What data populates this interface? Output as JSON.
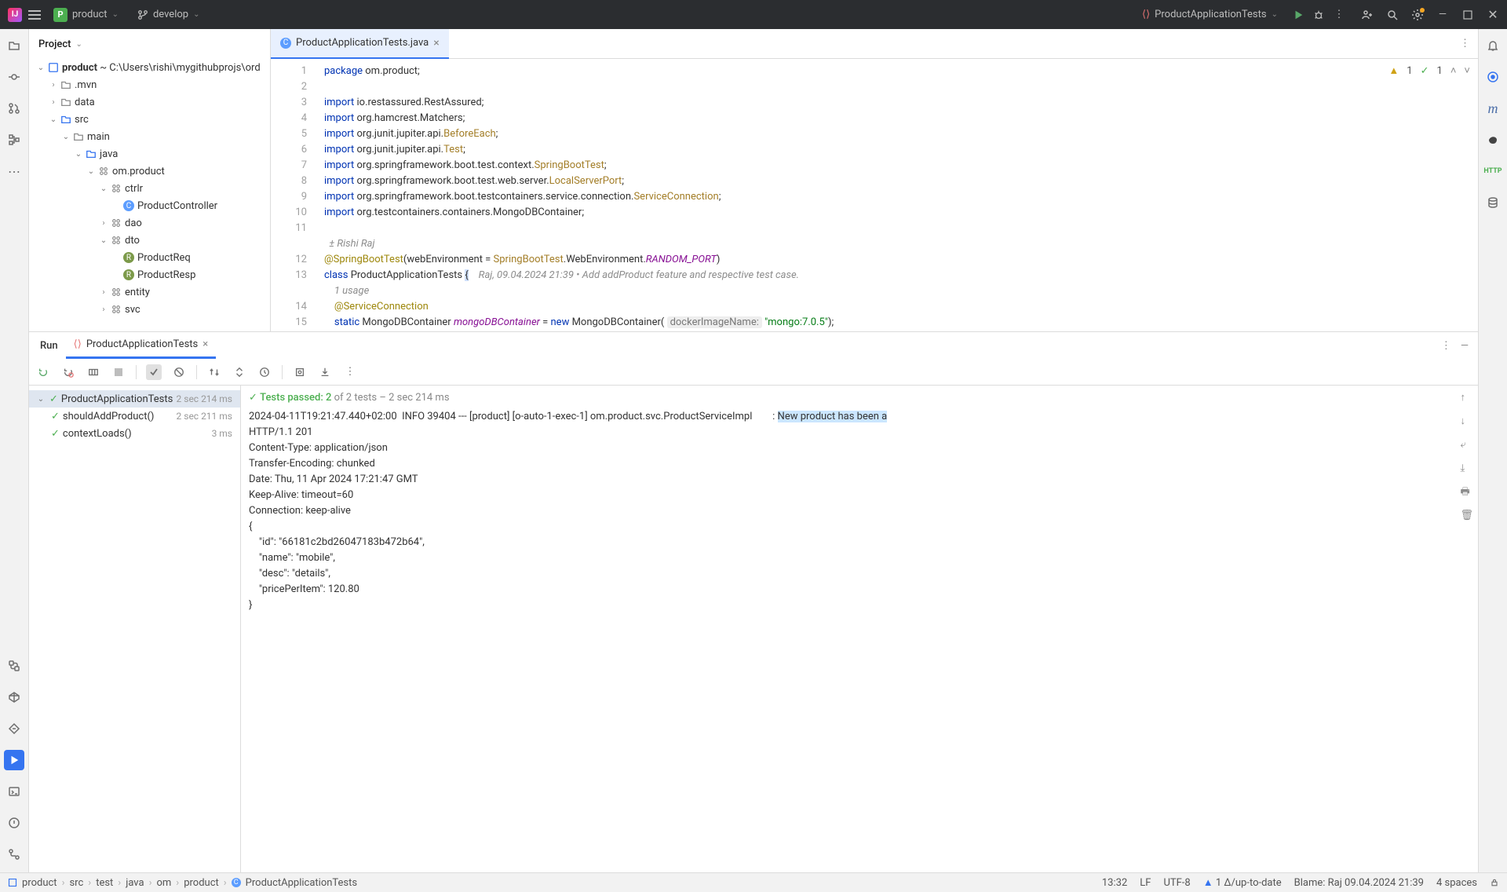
{
  "titlebar": {
    "project_name": "product",
    "branch": "develop",
    "run_config": "ProductApplicationTests"
  },
  "project_panel": {
    "title": "Project",
    "root": "product",
    "root_path": "~ C:\\Users\\rishi\\mygithubprojs\\ord",
    "tree": [
      {
        "indent": 1,
        "chev": "›",
        "type": "folder",
        "label": ".mvn"
      },
      {
        "indent": 1,
        "chev": "›",
        "type": "folder",
        "label": "data"
      },
      {
        "indent": 1,
        "chev": "⌄",
        "type": "src",
        "label": "src"
      },
      {
        "indent": 2,
        "chev": "⌄",
        "type": "folder",
        "label": "main"
      },
      {
        "indent": 3,
        "chev": "⌄",
        "type": "src",
        "label": "java"
      },
      {
        "indent": 4,
        "chev": "⌄",
        "type": "pkg",
        "label": "om.product"
      },
      {
        "indent": 5,
        "chev": "⌄",
        "type": "pkg",
        "label": "ctrlr"
      },
      {
        "indent": 6,
        "chev": "",
        "type": "class",
        "label": "ProductController"
      },
      {
        "indent": 5,
        "chev": "›",
        "type": "pkg",
        "label": "dao"
      },
      {
        "indent": 5,
        "chev": "⌄",
        "type": "pkg",
        "label": "dto"
      },
      {
        "indent": 6,
        "chev": "",
        "type": "record",
        "label": "ProductReq"
      },
      {
        "indent": 6,
        "chev": "",
        "type": "record",
        "label": "ProductResp"
      },
      {
        "indent": 5,
        "chev": "›",
        "type": "pkg",
        "label": "entity"
      },
      {
        "indent": 5,
        "chev": "›",
        "type": "pkg",
        "label": "svc"
      }
    ]
  },
  "editor": {
    "tab_file": "ProductApplicationTests.java",
    "author_hint": "Rishi Raj",
    "usage_hint": "1 usage",
    "blame_inline": "Raj, 09.04.2024 21:39 • Add addProduct feature and respective test case.",
    "inspections": {
      "warnings": "1",
      "passes": "1"
    },
    "lines": [
      {
        "n": "1",
        "html": "<span class='kw'>package</span> om.product;"
      },
      {
        "n": "2",
        "html": ""
      },
      {
        "n": "3",
        "html": "<span class='kw'>import</span> io.restassured.RestAssured;"
      },
      {
        "n": "4",
        "html": "<span class='kw'>import</span> org.hamcrest.Matchers;"
      },
      {
        "n": "5",
        "html": "<span class='kw'>import</span> org.junit.jupiter.api.<span class='type'>BeforeEach</span>;"
      },
      {
        "n": "6",
        "html": "<span class='kw'>import</span> org.junit.jupiter.api.<span class='type'>Test</span>;"
      },
      {
        "n": "7",
        "html": "<span class='kw'>import</span> org.springframework.boot.test.context.<span class='type'>SpringBootTest</span>;"
      },
      {
        "n": "8",
        "html": "<span class='kw'>import</span> org.springframework.boot.test.web.server.<span class='type'>LocalServerPort</span>;"
      },
      {
        "n": "9",
        "html": "<span class='kw'>import</span> org.springframework.boot.testcontainers.service.connection.<span class='type'>ServiceConnection</span>;"
      },
      {
        "n": "10",
        "html": "<span class='kw'>import</span> org.testcontainers.containers.MongoDBContainer;"
      },
      {
        "n": "11",
        "html": ""
      },
      {
        "n": "",
        "html": "<span class='cmt'>  ± Rishi Raj</span>"
      },
      {
        "n": "12",
        "html": "<span class='ann'>@SpringBootTest</span>(webEnvironment = <span class='type'>SpringBootTest</span>.WebEnvironment.<span class='field'>RANDOM_PORT</span>)"
      },
      {
        "n": "13",
        "html": "<span class='kw'>class</span> ProductApplicationTests <span class='hl'>{</span>    <span class='cmt'>Raj, 09.04.2024 21:39 • Add addProduct feature and respective test case.</span>"
      },
      {
        "n": "",
        "html": "    <span class='cmt'>1 usage</span>"
      },
      {
        "n": "14",
        "html": "    <span class='ann'>@ServiceConnection</span>"
      },
      {
        "n": "15",
        "html": "    <span class='kw'>static</span> MongoDBContainer <span class='field'>mongoDBContainer</span> = <span class='kw'>new</span> MongoDBContainer( <span class='hint'>dockerImageName:</span> <span class='str'>\"mongo:7.0.5\"</span>);"
      }
    ]
  },
  "run": {
    "title": "Run",
    "config_name": "ProductApplicationTests",
    "summary_pass": "Tests passed: 2",
    "summary_rest": " of 2 tests – 2 sec 214 ms",
    "tests": [
      {
        "name": "ProductApplicationTests",
        "time": "2 sec 214 ms",
        "root": true
      },
      {
        "name": "shouldAddProduct()",
        "time": "2 sec 211 ms"
      },
      {
        "name": "contextLoads()",
        "time": "3 ms"
      }
    ],
    "console_lines": [
      "2024-04-11T19:21:47.440+02:00  INFO 39404 --- [product] [o-auto-1-exec-1] om.product.svc.ProductServiceImpl        : <HL>New product has been a</HL>",
      "HTTP/1.1 201 ",
      "Content-Type: application/json",
      "Transfer-Encoding: chunked",
      "Date: Thu, 11 Apr 2024 17:21:47 GMT",
      "Keep-Alive: timeout=60",
      "Connection: keep-alive",
      "",
      "{",
      "    \"id\": \"66181c2bd26047183b472b64\",",
      "    \"name\": \"mobile\",",
      "    \"desc\": \"details\",",
      "    \"pricePerItem\": 120.80",
      "}"
    ]
  },
  "status": {
    "crumbs": [
      "product",
      "src",
      "test",
      "java",
      "om",
      "product",
      "ProductApplicationTests"
    ],
    "time": "13:32",
    "line_sep": "LF",
    "encoding": "UTF-8",
    "vcs": "1 Δ/up-to-date",
    "blame": "Blame: Raj 09.04.2024 21:39",
    "indent": "4 spaces"
  }
}
